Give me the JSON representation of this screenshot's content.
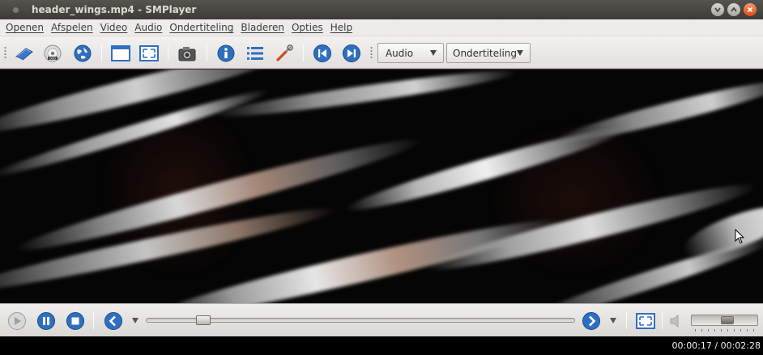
{
  "window": {
    "title": "header_wings.mp4 - SMPlayer",
    "controls": [
      "minimize-icon",
      "maximize-icon",
      "close-icon"
    ]
  },
  "menubar": {
    "items": [
      {
        "label": "Openen"
      },
      {
        "label": "Afspelen"
      },
      {
        "label": "Video"
      },
      {
        "label": "Audio"
      },
      {
        "label": "Ondertiteling"
      },
      {
        "label": "Bladeren"
      },
      {
        "label": "Opties"
      },
      {
        "label": "Help"
      }
    ]
  },
  "toolbar": {
    "icons": [
      "open-file-icon",
      "open-dvd-icon",
      "open-url-icon",
      "compact-mode-icon",
      "fullscreen-icon",
      "screenshot-icon",
      "info-icon",
      "playlist-icon",
      "preferences-icon",
      "previous-icon",
      "next-icon"
    ],
    "audio_combo": "Audio",
    "subtitle_combo": "Ondertiteling"
  },
  "controls": {
    "seek_fraction": 0.12,
    "volume_fraction": 0.55
  },
  "status": {
    "time": "00:00:17 / 00:02:28"
  },
  "colors": {
    "accent_blue": "#2f6fc0",
    "titlebar": "#3c3b37",
    "close_button": "#de4a14"
  }
}
